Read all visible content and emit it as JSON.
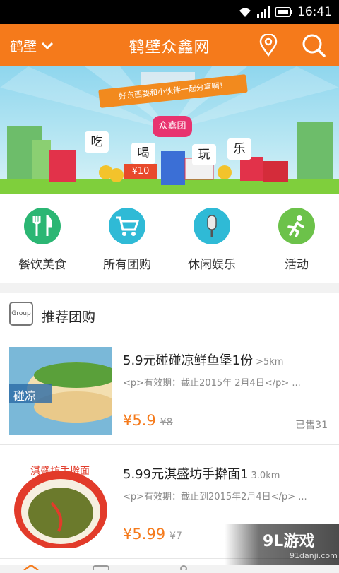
{
  "status_bar": {
    "time": "16:41"
  },
  "header": {
    "city": "鹤壁",
    "title": "鹤壁众鑫网"
  },
  "banner": {
    "ribbon_text": "好东西要和小伙伴一起分享啊！",
    "words": [
      "吃",
      "喝",
      "玩",
      "乐"
    ],
    "tag": "众鑫团",
    "price_tag": "¥10"
  },
  "categories": [
    {
      "label": "餐饮美食",
      "icon": "fork-knife-icon",
      "color": "#2bb673"
    },
    {
      "label": "所有团购",
      "icon": "cart-icon",
      "color": "#2fbad6"
    },
    {
      "label": "休闲娱乐",
      "icon": "microphone-icon",
      "color": "#2fbad6"
    },
    {
      "label": "活动",
      "icon": "runner-icon",
      "color": "#6cc24a"
    }
  ],
  "section": {
    "icon_text": "Group",
    "title": "推荐团购"
  },
  "deals": [
    {
      "title": "5.9元碰碰凉鲜鱼堡1份",
      "distance": ">5km",
      "desc": "<p>有效期：截止2015年 2月4日</p> ...",
      "price": "¥5.9",
      "orig_price": "¥8",
      "sold": "已售31",
      "thumb_text": "碰凉"
    },
    {
      "title": "5.99元淇盛坊手擀面1",
      "distance": "3.0km",
      "desc": "<p>有效期：截止到2015年2月4日</p> ...",
      "price": "¥5.99",
      "orig_price": "¥7",
      "sold": "",
      "thumb_text": "淇盛坊手擀面"
    }
  ],
  "watermark": {
    "main": "9L游戏",
    "sub": "91danji.com"
  },
  "colors": {
    "brand": "#f57a1b",
    "price": "#f57a1b"
  }
}
